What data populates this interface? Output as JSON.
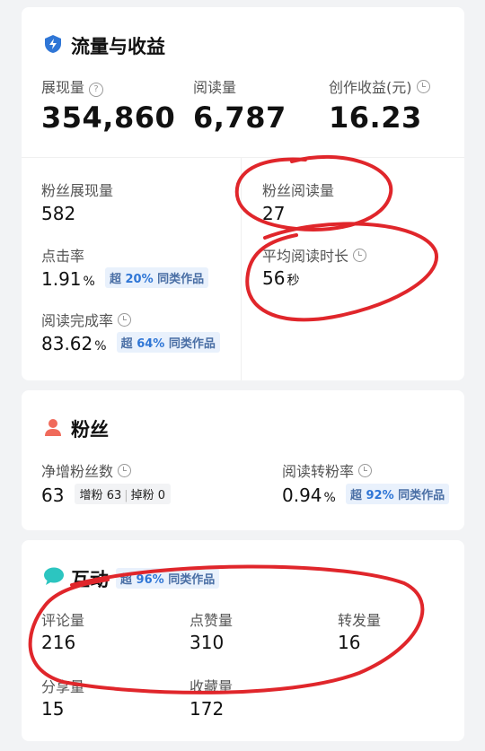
{
  "traffic": {
    "title": "流量与收益",
    "icon": "lightning-shield-icon",
    "impressions": {
      "label": "展现量",
      "value": "354,860"
    },
    "reads": {
      "label": "阅读量",
      "value": "6,787"
    },
    "earnings": {
      "label": "创作收益(元)",
      "value": "16.23"
    },
    "fan_impressions": {
      "label": "粉丝展现量",
      "value": "582"
    },
    "fan_reads": {
      "label": "粉丝阅读量",
      "value": "27"
    },
    "ctr": {
      "label": "点击率",
      "value": "1.91",
      "unit": "%",
      "badge_prefix": "超",
      "badge_value": "20%",
      "badge_suffix": "同类作品"
    },
    "avg_time": {
      "label": "平均阅读时长",
      "value": "56",
      "unit": "秒"
    },
    "completion": {
      "label": "阅读完成率",
      "value": "83.62",
      "unit": "%",
      "badge_prefix": "超",
      "badge_value": "64%",
      "badge_suffix": "同类作品"
    }
  },
  "fans": {
    "title": "粉丝",
    "icon": "person-icon",
    "net_gain": {
      "label": "净增粉丝数",
      "value": "63",
      "gain_label": "增粉",
      "gain_value": "63",
      "loss_label": "掉粉",
      "loss_value": "0"
    },
    "conversion": {
      "label": "阅读转粉率",
      "value": "0.94",
      "unit": "%",
      "badge_prefix": "超",
      "badge_value": "92%",
      "badge_suffix": "同类作品"
    }
  },
  "interaction": {
    "title": "互动",
    "icon": "chat-bubble-icon",
    "badge_prefix": "超",
    "badge_value": "96%",
    "badge_suffix": "同类作品",
    "comments": {
      "label": "评论量",
      "value": "216"
    },
    "likes": {
      "label": "点赞量",
      "value": "310"
    },
    "reposts": {
      "label": "转发量",
      "value": "16"
    },
    "shares": {
      "label": "分享量",
      "value": "15"
    },
    "favorites": {
      "label": "收藏量",
      "value": "172"
    }
  },
  "colors": {
    "accent": "#2f76d6",
    "annotation": "#e0262b",
    "badge_bg": "#e9f1fc"
  }
}
